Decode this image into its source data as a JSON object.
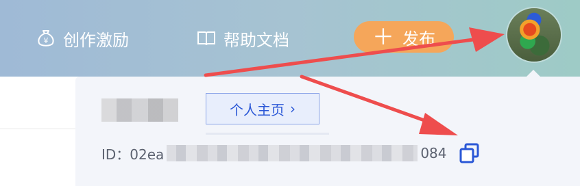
{
  "header": {
    "nav": [
      {
        "label": "创作激励",
        "icon": "money-bag-icon"
      },
      {
        "label": "帮助文档",
        "icon": "book-icon"
      }
    ],
    "publish_label": "发布"
  },
  "popup": {
    "home_link_label": "个人主页",
    "id_prefix": "ID：02ea",
    "id_suffix": "084"
  },
  "colors": {
    "accent_blue": "#2a57d6",
    "publish_orange": "#f5a65a",
    "arrow_red": "#ee4d4d"
  }
}
